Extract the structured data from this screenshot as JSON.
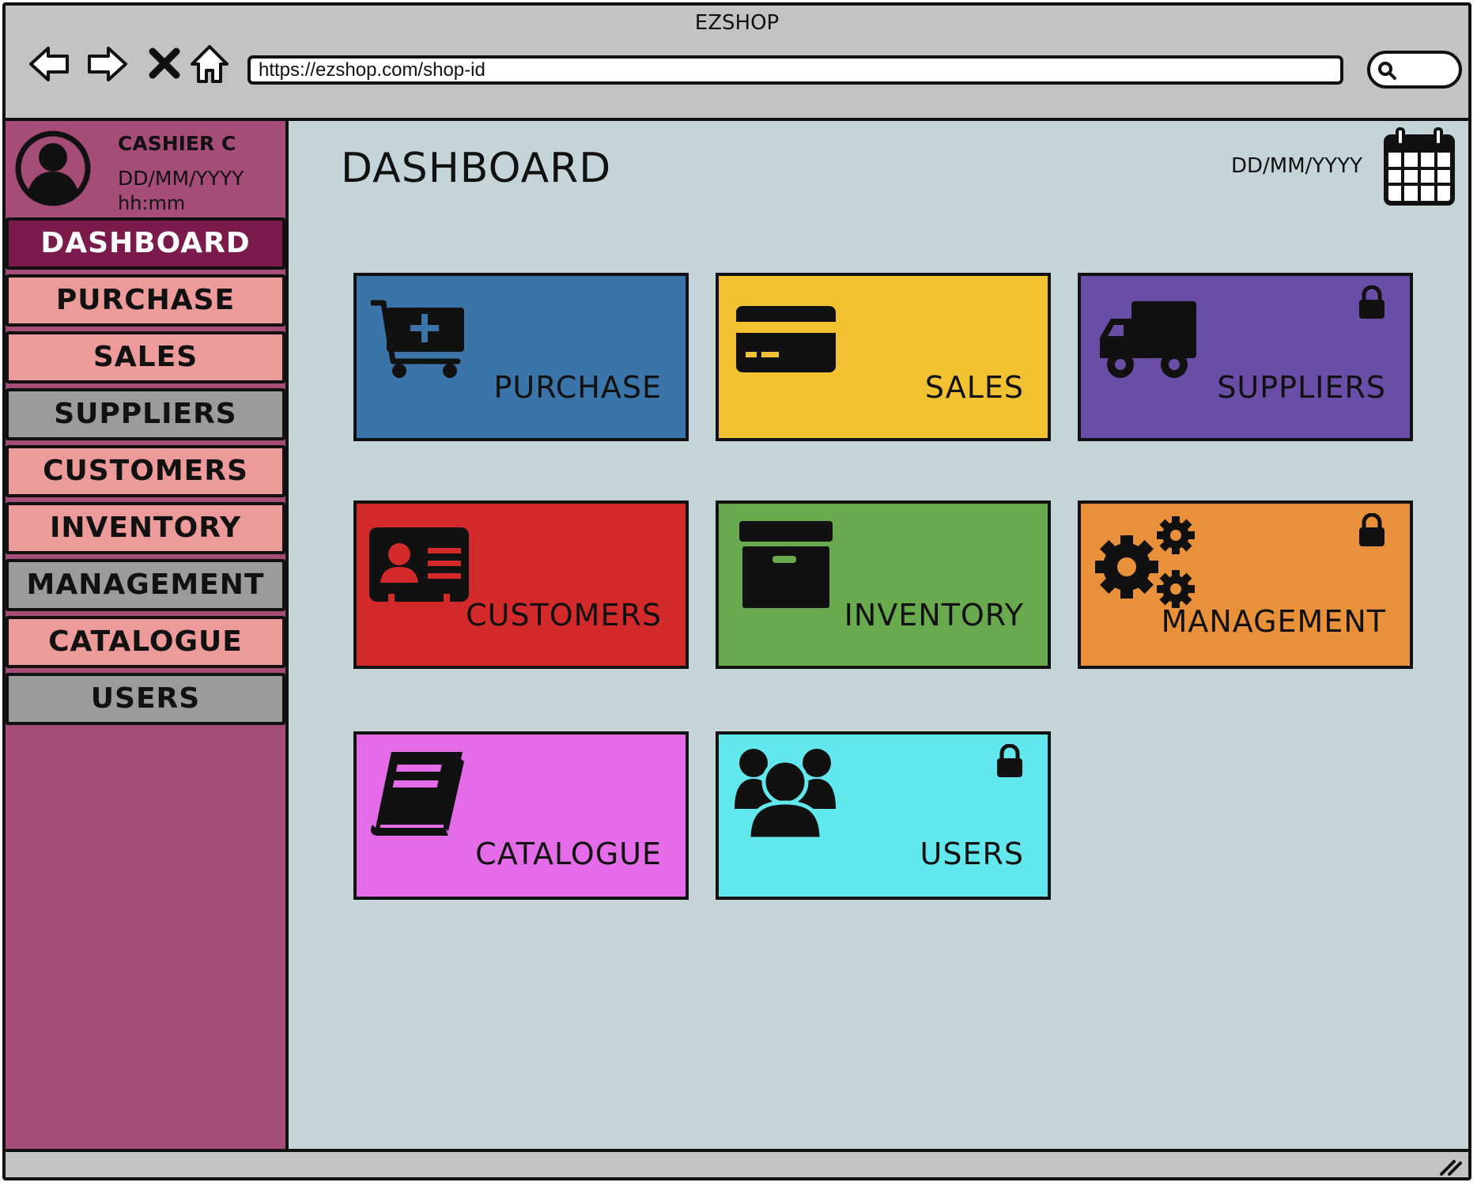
{
  "window": {
    "title": "EZSHOP"
  },
  "browser": {
    "back_icon": "back-arrow-icon",
    "forward_icon": "forward-arrow-icon",
    "close_icon": "close-icon",
    "home_icon": "home-icon",
    "url": "https://ezshop.com/shop-id",
    "search_icon": "search-icon"
  },
  "profile": {
    "name": "CASHIER C",
    "date": "DD/MM/YYYY",
    "time": "hh:mm",
    "avatar_icon": "user-avatar-icon"
  },
  "sidebar": {
    "items": [
      {
        "label": "DASHBOARD",
        "state": "active"
      },
      {
        "label": "PURCHASE",
        "state": "enabled"
      },
      {
        "label": "SALES",
        "state": "enabled"
      },
      {
        "label": "SUPPLIERS",
        "state": "disabled"
      },
      {
        "label": "CUSTOMERS",
        "state": "enabled"
      },
      {
        "label": "INVENTORY",
        "state": "enabled"
      },
      {
        "label": "MANAGEMENT",
        "state": "disabled"
      },
      {
        "label": "CATALOGUE",
        "state": "enabled"
      },
      {
        "label": "USERS",
        "state": "disabled"
      }
    ]
  },
  "main": {
    "title": "DASHBOARD",
    "date": "DD/MM/YYYY",
    "calendar_icon": "calendar-icon",
    "tiles": [
      {
        "label": "PURCHASE",
        "color": "#3a74a8",
        "icon": "cart-add-icon",
        "locked": false
      },
      {
        "label": "SALES",
        "color": "#f2c232",
        "icon": "credit-card-icon",
        "locked": false
      },
      {
        "label": "SUPPLIERS",
        "color": "#6a4da6",
        "icon": "truck-icon",
        "locked": true
      },
      {
        "label": "CUSTOMERS",
        "color": "#d22a2a",
        "icon": "id-card-icon",
        "locked": false
      },
      {
        "label": "INVENTORY",
        "color": "#6aaa4e",
        "icon": "archive-box-icon",
        "locked": false
      },
      {
        "label": "MANAGEMENT",
        "color": "#e8903a",
        "icon": "gears-icon",
        "locked": true
      },
      {
        "label": "CATALOGUE",
        "color": "#e46ce8",
        "icon": "book-icon",
        "locked": false
      },
      {
        "label": "USERS",
        "color": "#62e8ec",
        "icon": "users-group-icon",
        "locked": true
      }
    ]
  },
  "colors": {
    "chrome": "#c3c3c3",
    "sidebar_bg": "#a64c79",
    "sidebar_active": "#7a1b4c",
    "sidebar_enabled": "#ec9a9a",
    "sidebar_disabled": "#9b9b9b",
    "main_bg": "#c4d4d8"
  }
}
